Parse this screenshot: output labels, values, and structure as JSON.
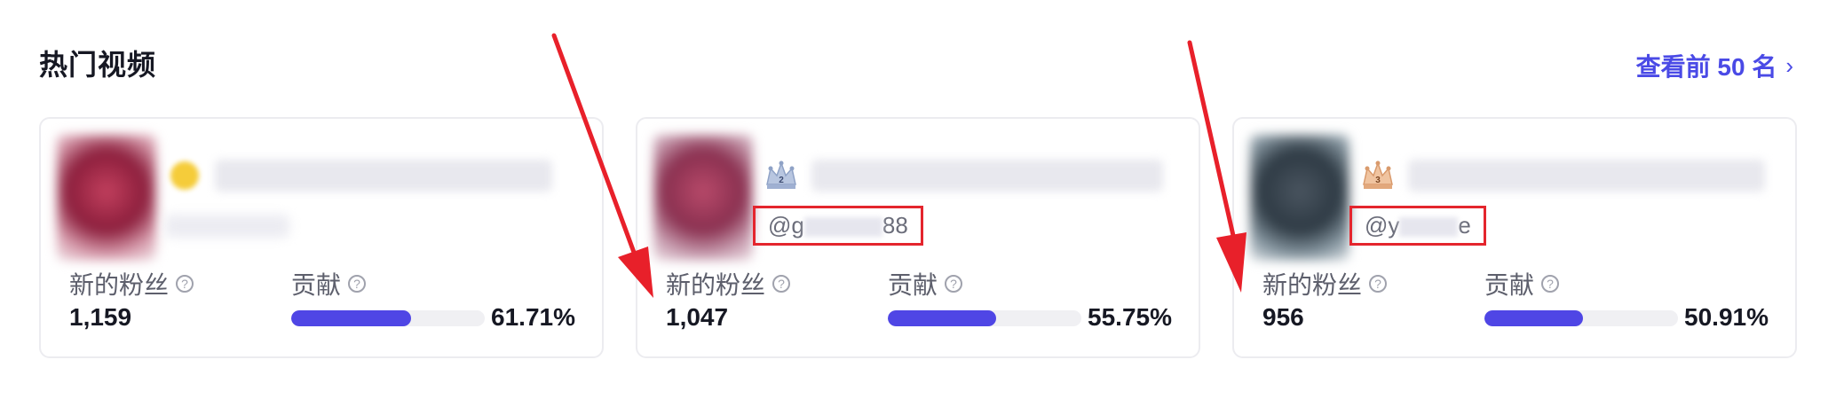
{
  "section": {
    "title": "热门视频",
    "view_top_label": "查看前 50 名"
  },
  "cards": [
    {
      "rank": 1,
      "handle_visible": "",
      "followers_label": "新的粉丝",
      "followers": "1,159",
      "contribution_label": "贡献",
      "contribution_pct": "61.71%",
      "contribution_fraction": 0.6171
    },
    {
      "rank": 2,
      "handle_prefix": "@g",
      "handle_suffix": "88",
      "followers_label": "新的粉丝",
      "followers": "1,047",
      "contribution_label": "贡献",
      "contribution_pct": "55.75%",
      "contribution_fraction": 0.5575
    },
    {
      "rank": 3,
      "handle_prefix": "@y",
      "handle_suffix": "e",
      "followers_label": "新的粉丝",
      "followers": "956",
      "contribution_label": "贡献",
      "contribution_pct": "50.91%",
      "contribution_fraction": 0.5091
    }
  ],
  "colors": {
    "accent": "#4a4ae6",
    "bar_fill": "#4f46e5",
    "highlight_box": "#e4252d",
    "arrow": "#e8202a"
  }
}
